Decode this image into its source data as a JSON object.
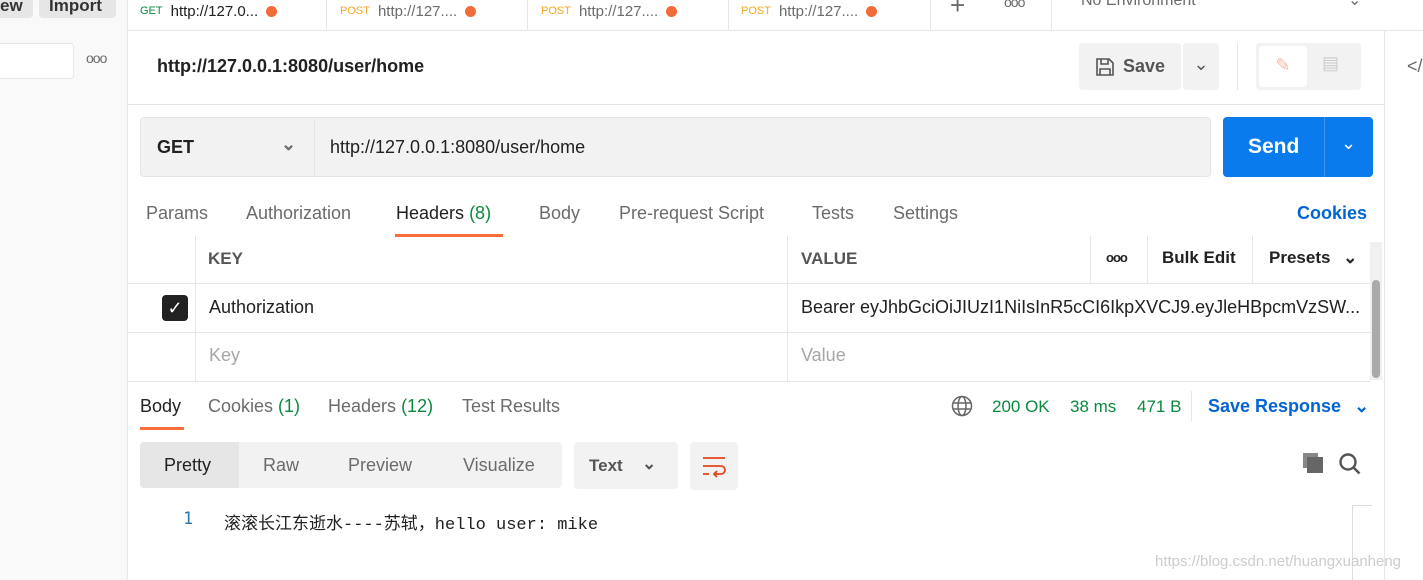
{
  "sidebar": {
    "new_label": "ew",
    "import_label": "Import",
    "more_icon": "more-icon"
  },
  "tabs": [
    {
      "method": "GET",
      "title": "http://127.0...",
      "method_color": "#0b8a3f"
    },
    {
      "method": "POST",
      "title": "http://127....",
      "method_color": "#f5a623"
    },
    {
      "method": "POST",
      "title": "http://127....",
      "method_color": "#f5a623"
    },
    {
      "method": "POST",
      "title": "http://127....",
      "method_color": "#f5a623"
    }
  ],
  "environment": "No Environment",
  "request": {
    "title": "http://127.0.0.1:8080/user/home",
    "save_label": "Save",
    "method": "GET",
    "url": "http://127.0.0.1:8080/user/home",
    "send_label": "Send"
  },
  "request_tabs": [
    {
      "label": "Params"
    },
    {
      "label": "Authorization"
    },
    {
      "label": "Headers",
      "count": "(8)"
    },
    {
      "label": "Body"
    },
    {
      "label": "Pre-request Script"
    },
    {
      "label": "Tests"
    },
    {
      "label": "Settings"
    }
  ],
  "cookies_link": "Cookies",
  "headers_table": {
    "key_header": "KEY",
    "value_header": "VALUE",
    "bulk_edit": "Bulk Edit",
    "presets": "Presets",
    "rows": [
      {
        "checked": true,
        "key": "Authorization",
        "value": "Bearer eyJhbGciOiJIUzI1NiIsInR5cCI6IkpXVCJ9.eyJleHBpcmVzSW..."
      }
    ],
    "key_placeholder": "Key",
    "value_placeholder": "Value"
  },
  "response": {
    "tabs": [
      {
        "label": "Body"
      },
      {
        "label": "Cookies",
        "count": "(1)"
      },
      {
        "label": "Headers",
        "count": "(12)"
      },
      {
        "label": "Test Results"
      }
    ],
    "status": "200 OK",
    "time": "38 ms",
    "size": "471 B",
    "save_response": "Save Response",
    "views": [
      "Pretty",
      "Raw",
      "Preview",
      "Visualize"
    ],
    "format": "Text",
    "lines": [
      {
        "num": "1",
        "text": "滚滚长江东逝水----苏轼，hello user: mike"
      }
    ]
  },
  "watermark": "https://blog.csdn.net/huangxuanheng",
  "colors": {
    "accent": "#ff6c37",
    "send": "#097bed",
    "link": "#0265d2",
    "status": "#0b8a3f"
  }
}
